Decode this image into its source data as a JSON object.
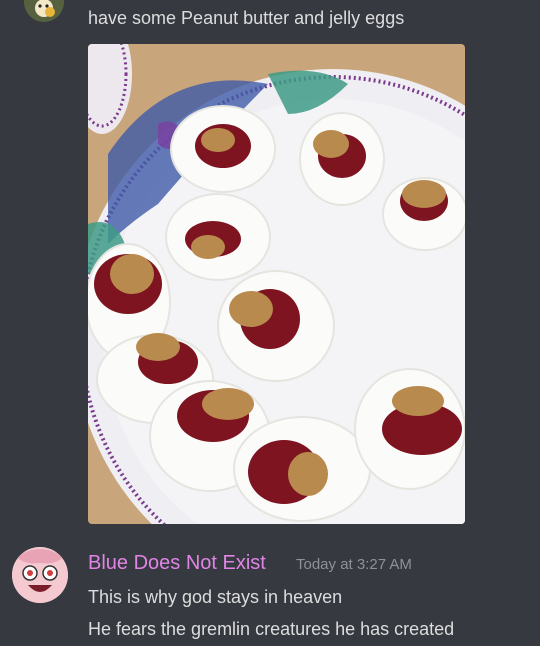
{
  "messages": [
    {
      "text": "have some Peanut butter and jelly eggs",
      "attachment": {
        "type": "image"
      }
    },
    {
      "author": "Blue Does Not Exist",
      "author_color": "#e084e6",
      "timestamp": "Today at 3:27 AM",
      "lines": [
        "This is why god stays in heaven",
        "He fears the gremlin creatures he has created"
      ]
    }
  ],
  "theme": {
    "background": "#36393f",
    "text": "#dcddde",
    "muted": "#8e9297"
  }
}
